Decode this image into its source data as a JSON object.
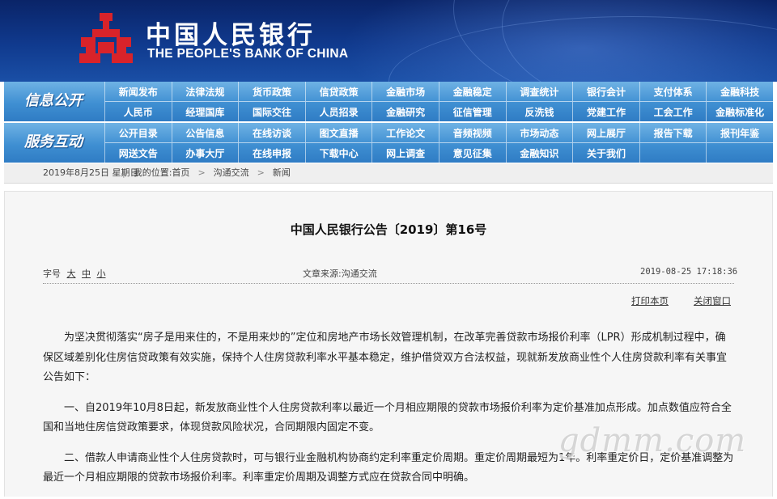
{
  "header": {
    "bank_name_cn": "中国人民银行",
    "bank_name_en": "THE PEOPLE'S BANK OF CHINA",
    "logo_icon": "pboc-logo-icon",
    "colors": {
      "banner": "#0f357f",
      "logo": "#d8232a",
      "nav": "#3f8fd2"
    }
  },
  "nav1": {
    "title": "信息公开",
    "items": [
      {
        "label": "新闻发布"
      },
      {
        "label": "法律法规"
      },
      {
        "label": "货币政策"
      },
      {
        "label": "信贷政策"
      },
      {
        "label": "金融市场"
      },
      {
        "label": "金融稳定"
      },
      {
        "label": "调查统计"
      },
      {
        "label": "银行会计"
      },
      {
        "label": "支付体系"
      },
      {
        "label": "金融科技"
      },
      {
        "label": "人民币"
      },
      {
        "label": "经理国库"
      },
      {
        "label": "国际交往"
      },
      {
        "label": "人员招录"
      },
      {
        "label": "金融研究"
      },
      {
        "label": "征信管理"
      },
      {
        "label": "反洗钱"
      },
      {
        "label": "党建工作"
      },
      {
        "label": "工会工作"
      },
      {
        "label": "金融标准化"
      }
    ]
  },
  "nav2": {
    "title": "服务互动",
    "items": [
      {
        "label": "公开目录"
      },
      {
        "label": "公告信息"
      },
      {
        "label": "在线访谈"
      },
      {
        "label": "图文直播"
      },
      {
        "label": "工作论文"
      },
      {
        "label": "音频视频"
      },
      {
        "label": "市场动态"
      },
      {
        "label": "网上展厅"
      },
      {
        "label": "报告下载"
      },
      {
        "label": "报刊年鉴"
      },
      {
        "label": "网送文告"
      },
      {
        "label": "办事大厅"
      },
      {
        "label": "在线申报"
      },
      {
        "label": "下载中心"
      },
      {
        "label": "网上调查"
      },
      {
        "label": "意见征集"
      },
      {
        "label": "金融知识"
      },
      {
        "label": "关于我们"
      },
      {
        "label": ""
      },
      {
        "label": ""
      }
    ]
  },
  "breadcrumb": {
    "date": "2019年8月25日 星期日",
    "location_label": "我的位置:",
    "home": "首页",
    "section": "沟通交流",
    "current": "新闻"
  },
  "article": {
    "title": "中国人民银行公告〔2019〕第16号",
    "font_size_label": "字号",
    "size_large": "大",
    "size_medium": "中",
    "size_small": "小",
    "source": "文章来源:沟通交流",
    "timestamp": "2019-08-25 17:18:36",
    "print_link": "打印本页",
    "close_link": "关闭窗口",
    "paragraphs": [
      "为坚决贯彻落实“房子是用来住的，不是用来炒的”定位和房地产市场长效管理机制，在改革完善贷款市场报价利率（LPR）形成机制过程中，确保区域差别化住房信贷政策有效实施，保持个人住房贷款利率水平基本稳定，维护借贷双方合法权益，现就新发放商业性个人住房贷款利率有关事宜公告如下：",
      "一、自2019年10月8日起，新发放商业性个人住房贷款利率以最近一个月相应期限的贷款市场报价利率为定价基准加点形成。加点数值应符合全国和当地住房信贷政策要求，体现贷款风险状况，合同期限内固定不变。",
      "二、借款人申请商业性个人住房贷款时，可与银行业金融机构协商约定利率重定价周期。重定价周期最短为1年。利率重定价日，定价基准调整为最近一个月相应期限的贷款市场报价利率。利率重定价周期及调整方式应在贷款合同中明确。"
    ]
  },
  "watermark": "gdmm.com"
}
